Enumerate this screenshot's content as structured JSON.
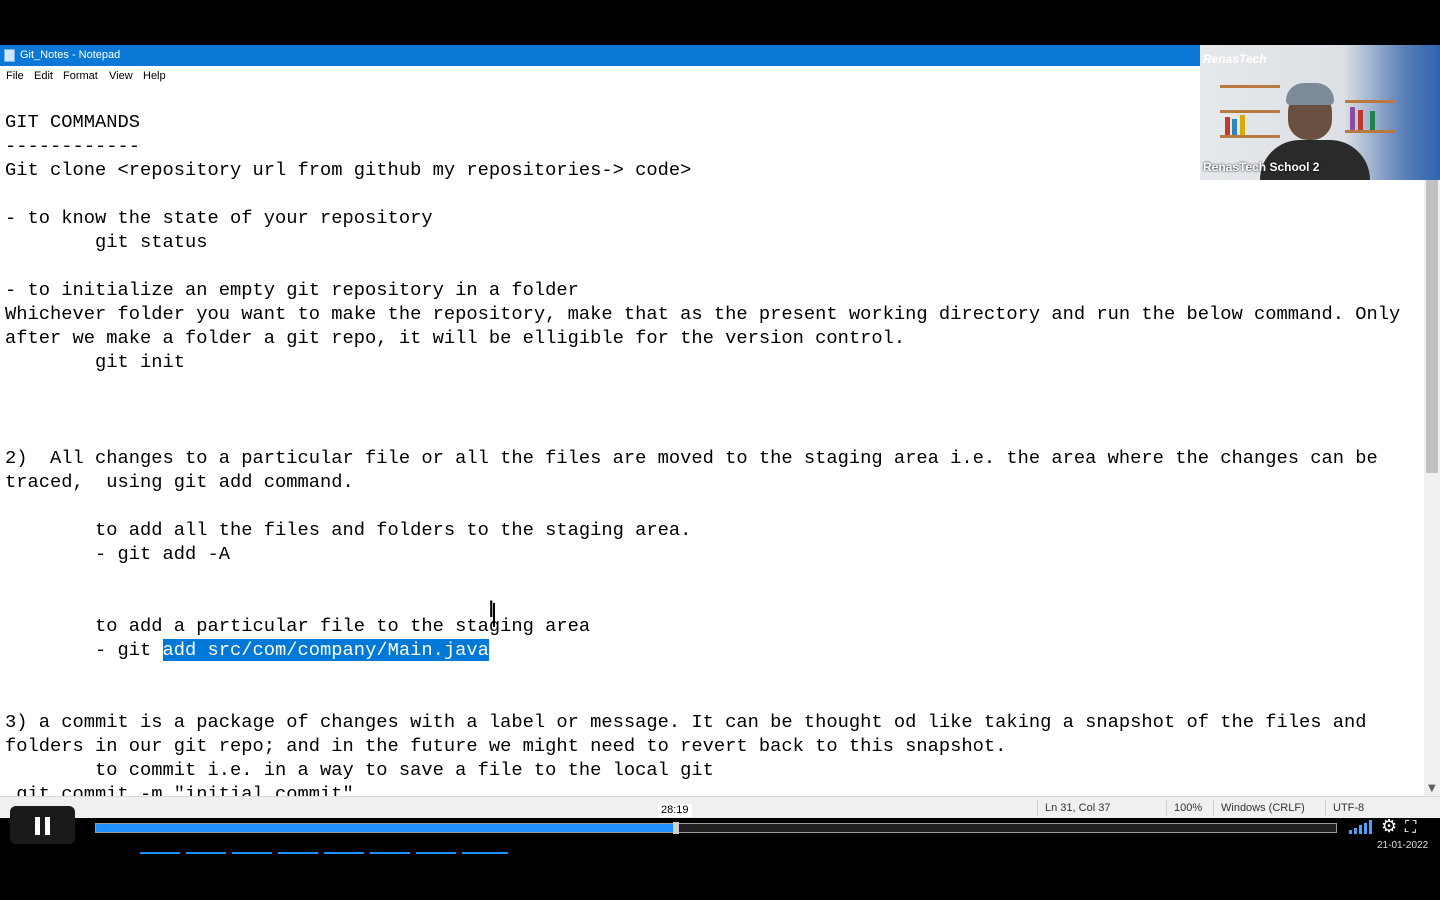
{
  "window": {
    "title": "Git_Notes - Notepad"
  },
  "menu": [
    "File",
    "Edit",
    "Format",
    "View",
    "Help"
  ],
  "editor": {
    "lines": [
      {
        "text": ""
      },
      {
        "text": "GIT COMMANDS"
      },
      {
        "text": "------------"
      },
      {
        "text": "Git clone <repository url from github my repositories-> code>"
      },
      {
        "text": ""
      },
      {
        "text": "- to know the state of your repository"
      },
      {
        "text": "        git status"
      },
      {
        "text": ""
      },
      {
        "text": "- to initialize an empty git repository in a folder"
      },
      {
        "text": "Whichever folder you want to make the repository, make that as the present working directory and run the below command. Only"
      },
      {
        "text": "after we make a folder a git repo, it will be elligible for the version control."
      },
      {
        "text": "        git init"
      },
      {
        "text": ""
      },
      {
        "text": ""
      },
      {
        "text": ""
      },
      {
        "text": "2)  All changes to a particular file or all the files are moved to the staging area i.e. the area where the changes can be"
      },
      {
        "text": "traced,  using git add command."
      },
      {
        "text": ""
      },
      {
        "text": "        to add all the files and folders to the staging area."
      },
      {
        "text": "        - git add -A"
      },
      {
        "text": ""
      },
      {
        "text": ""
      },
      {
        "text": "        to add a particular file to the staging area"
      },
      {
        "text": "        - git ",
        "selected": "add src/com/company/Main.java"
      },
      {
        "text": ""
      },
      {
        "text": ""
      },
      {
        "text": "3) a commit is a package of changes with a label or message. It can be thought od like taking a snapshot of the files and"
      },
      {
        "text": "folders in our git repo; and in the future we might need to revert back to this snapshot."
      },
      {
        "text": "        to commit i.e. in a way to save a file to the local git"
      },
      {
        "text": " git commit -m \"initial commit\""
      }
    ]
  },
  "status": {
    "position": "Ln 31, Col 37",
    "zoom": "100%",
    "line_ending": "Windows (CRLF)",
    "encoding": "UTF-8"
  },
  "webcam": {
    "brand": "RenasTech",
    "label": "RenasTech School 2"
  },
  "player": {
    "timecode": "28:19",
    "progress_fraction": 0.468,
    "date": "21-01-2022"
  }
}
